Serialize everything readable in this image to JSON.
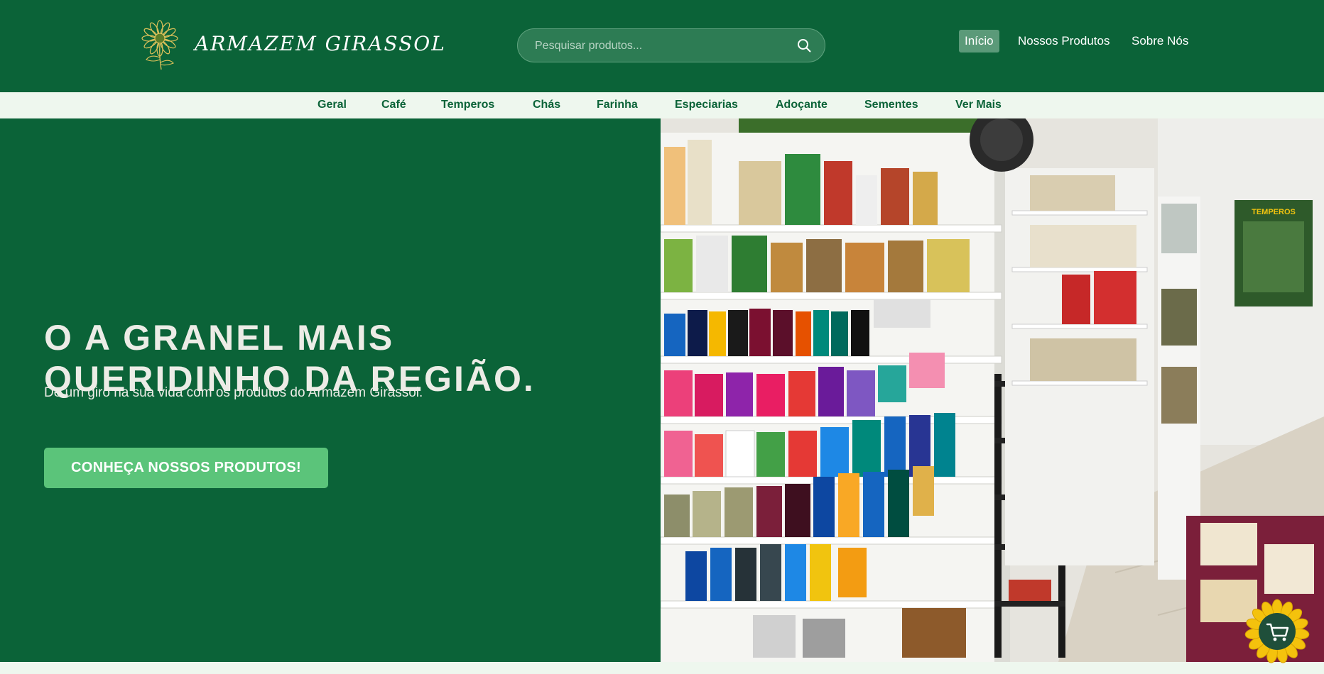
{
  "header": {
    "brand": "ARMAZEM GIRASSOL",
    "search_placeholder": "Pesquisar produtos...",
    "nav": [
      "Início",
      "Nossos Produtos",
      "Sobre Nós"
    ]
  },
  "categories": [
    "Geral",
    "Café",
    "Temperos",
    "Chás",
    "Farinha",
    "Especiarias",
    "Adoçante",
    "Sementes",
    "Ver Mais"
  ],
  "hero": {
    "title_lines": [
      "O A GRANEL MAIS",
      "QUERIDINHO DA REGIÃO."
    ],
    "subtitle": "De um giro na sua vida com os produtos do Armazem Girassol.",
    "cta_label": "CONHEÇA NOSSOS PRODUTOS!",
    "photo_sign_text": "TEMPEROS"
  },
  "colors": {
    "primary_green": "#0b6338",
    "light_mint": "#eef7ee",
    "cta_green": "#5bc47a",
    "sunflower_yellow": "#f4c20d"
  },
  "icons": {
    "logo": "sunflower-logo-icon",
    "search": "search-icon",
    "cart": "shopping-cart-icon"
  }
}
